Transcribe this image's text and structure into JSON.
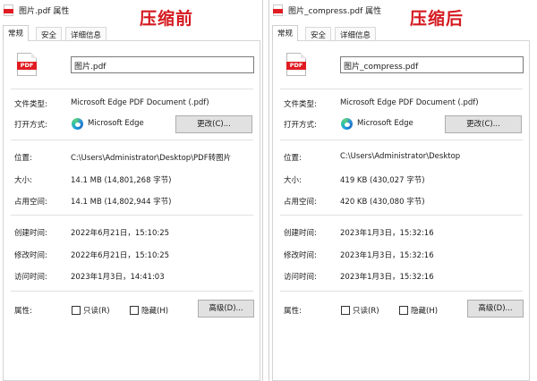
{
  "before": {
    "window_title": "图片.pdf 属性",
    "caption": "压缩前",
    "tabs": [
      "常规",
      "安全",
      "详细信息"
    ],
    "icon_text": "PDF",
    "file_name": "图片.pdf",
    "type_label": "文件类型:",
    "type_value": "Microsoft Edge PDF Document (.pdf)",
    "open_label": "打开方式:",
    "open_value": "Microsoft Edge",
    "change_button": "更改(C)...",
    "location_label": "位置:",
    "location_value": "C:\\Users\\Administrator\\Desktop\\PDF转图片",
    "size_label": "大小:",
    "size_value": "14.1 MB (14,801,268 字节)",
    "disk_label": "占用空间:",
    "disk_value": "14.1 MB (14,802,944 字节)",
    "created_label": "创建时间:",
    "created_value": "2022年6月21日，15:10:25",
    "modified_label": "修改时间:",
    "modified_value": "2022年6月21日，15:10:25",
    "accessed_label": "访问时间:",
    "accessed_value": "2023年1月3日，14:41:03",
    "attr_label": "属性:",
    "readonly_label": "只读(R)",
    "hidden_label": "隐藏(H)",
    "advanced_button": "高级(D)..."
  },
  "after": {
    "window_title": "图片_compress.pdf 属性",
    "caption": "压缩后",
    "tabs": [
      "常规",
      "安全",
      "详细信息"
    ],
    "icon_text": "PDF",
    "file_name": "图片_compress.pdf",
    "type_label": "文件类型:",
    "type_value": "Microsoft Edge PDF Document (.pdf)",
    "open_label": "打开方式:",
    "open_value": "Microsoft Edge",
    "change_button": "更改(C)...",
    "location_label": "位置:",
    "location_value": "C:\\Users\\Administrator\\Desktop",
    "size_label": "大小:",
    "size_value": "419 KB (430,027 字节)",
    "disk_label": "占用空间:",
    "disk_value": "420 KB (430,080 字节)",
    "created_label": "创建时间:",
    "created_value": "2023年1月3日，15:32:16",
    "modified_label": "修改时间:",
    "modified_value": "2023年1月3日，15:32:16",
    "accessed_label": "访问时间:",
    "accessed_value": "2023年1月3日，15:32:16",
    "attr_label": "属性:",
    "readonly_label": "只读(R)",
    "hidden_label": "隐藏(H)",
    "advanced_button": "高级(D)..."
  },
  "colors": {
    "accent_red": "#d4191f",
    "pdf_red": "#e11b22"
  },
  "icons": [
    "pdf-file-icon",
    "edge-icon",
    "checkbox"
  ]
}
